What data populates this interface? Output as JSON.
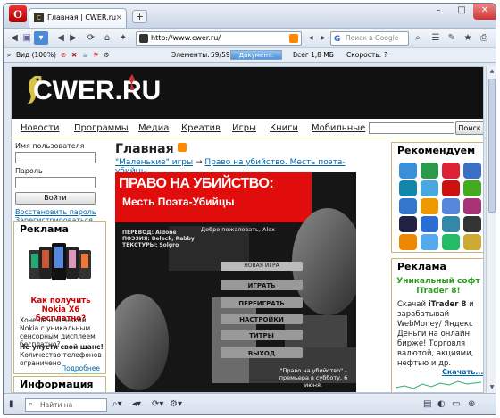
{
  "browser": {
    "menu_glyph": "O",
    "tab_title": "Главная | CWER.ru",
    "tab_favicon": "C",
    "url": "http://www.cwer.ru/",
    "search_placeholder": "Поиск в Google",
    "search_engine_glyph": "G",
    "view_label": "Вид (100%)",
    "elements_label": "Элементы:",
    "elements_value": "59/59",
    "document_label": "Документ: 100%",
    "document_progress_pct": 100,
    "total_label": "Всег",
    "total_value": "1,8 МБ",
    "speed_label": "Скорость:",
    "speed_value": "?",
    "find_placeholder": "Найти на странице"
  },
  "site": {
    "logo_text": "CWER.RU",
    "menu": [
      "Новости",
      "Программы",
      "Медиа",
      "Креатив",
      "Игры",
      "Книги",
      "Мобильные"
    ],
    "search_button": "Поиск",
    "login": {
      "username_label": "Имя пользователя",
      "password_label": "Пароль",
      "submit_label": "Войти",
      "restore_link": "Восстановить пароль",
      "register_link": "Зарегистрироваться"
    },
    "left_ad": {
      "title": "Реклама",
      "headline": "Как получить Nokia X6 бесплатно?",
      "text1": "Хочешь новенький Nokia с уникальным сенсорным дисплеем бесплатно?",
      "headline2": "Не упусти свой шанс!",
      "text2": "Количество телефонов ограничено.",
      "more_link": "Подробнее"
    },
    "info_box_title": "Информация",
    "main": {
      "title": "Главная",
      "crumb_link1": "\"Маленькие\" игры",
      "crumb_arrow": "→",
      "crumb_link2": "Право на убийство. Месть поэта-убийцы",
      "poster_title": "ПРАВО НА УБИЙСТВО:",
      "poster_subtitle": "Месть Поэта-Убийцы",
      "poster_credits": "ПЕРЕВОД: Aldone\nПОЭЗИЯ: Beleck, Rabby\nТЕКСТУРЫ: Solgro",
      "poster_welcome": "Добро пожаловать, Alex",
      "poster_menu": [
        "НОВАЯ ИГРА",
        "ИГРАТЬ",
        "ПЕРЕИГРАТЬ",
        "НАСТРОЙКИ",
        "ТИТРЫ",
        "ВЫХОД"
      ],
      "poster_caption": "\"Право на убийство\" - премьера в субботу, 6 июня."
    },
    "right": {
      "recommend_title": "Рекомендуем",
      "icons": [
        "win-logo-icon",
        "alien-icon",
        "circle-icon",
        "globe-icon",
        "skype-icon",
        "sky-icon",
        "opera-red-icon",
        "books-icon",
        "ie-icon",
        "cubes-icon",
        "browser-icon",
        "stack-icon",
        "game-icon",
        "photoshop-icon",
        "chart-icon",
        "phone-icon",
        "vlc-icon",
        "transfer-icon",
        "hat-icon",
        "mail-icon"
      ],
      "ad_title": "Реклама",
      "ad_headline": "Уникальный софт iTrader 8!",
      "ad_text_1": "Скачай",
      "ad_text_bold": "iTrader 8",
      "ad_text_2": "и зарабатывай WebMoney/ Яндекс Деньги на онлайн бирже! Торговля валютой, акциями, нефтью и др.",
      "ad_link": "Скачать..."
    }
  }
}
